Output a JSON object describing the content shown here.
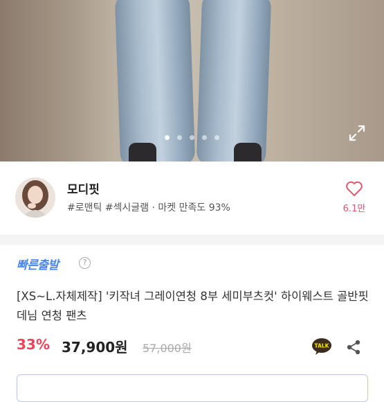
{
  "gallery": {
    "image_count": 5,
    "active_index": 0
  },
  "shop": {
    "name": "모디핏",
    "meta": "#로맨틱 #섹시글램 · 마켓 만족도 93%",
    "like_count": "6.1만"
  },
  "product": {
    "badge": "빠른출발",
    "help_symbol": "?",
    "title": "[XS~L.자체제작] '키작녀 그레이연청 8부 세미부츠컷' 하이웨스트 골반핏 데님 연청 팬츠",
    "discount": "33%",
    "price": "37,900원",
    "original_price": "57,000원"
  },
  "colors": {
    "accent_blue": "#4a86f0",
    "discount_red": "#f0425a",
    "like_pink": "#e0566c",
    "kakao_talk": "#3c2b1f"
  },
  "icons": {
    "expand": "expand-icon",
    "like": "heart-icon",
    "talk": "talk-icon",
    "share": "share-icon"
  }
}
